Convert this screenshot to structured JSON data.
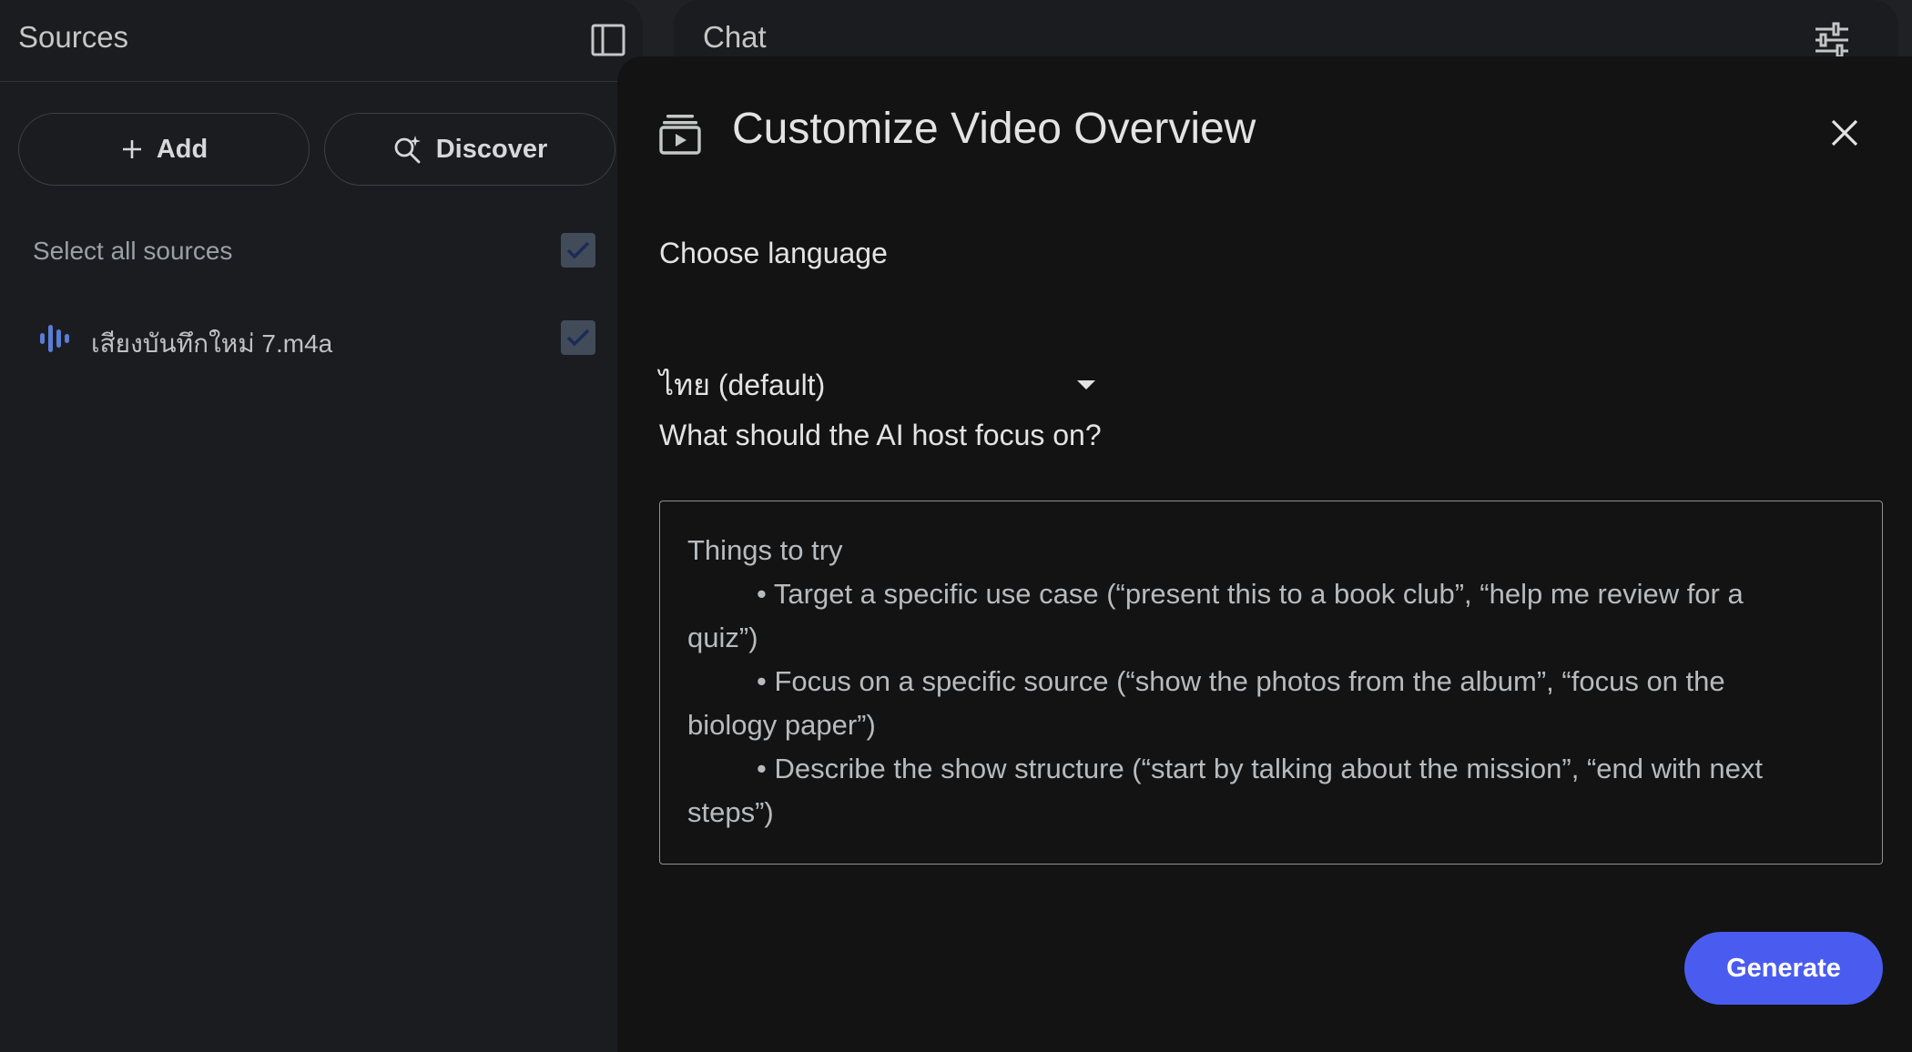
{
  "sources": {
    "title": "Sources",
    "add_label": "Add",
    "discover_label": "Discover",
    "select_all_label": "Select all sources",
    "items": [
      {
        "name": "เสียงบันทึกใหม่ 7.m4a"
      }
    ]
  },
  "chat": {
    "title": "Chat"
  },
  "modal": {
    "title": "Customize Video Overview",
    "language_label": "Choose language",
    "language_value": "ไทย (default)",
    "focus_label": "What should the AI host focus on?",
    "placeholder": {
      "heading": "Things to try",
      "tips": [
        "• Target a specific use case (“present this to a book club”, “help me review for a",
        "quiz”)",
        "• Focus on a specific source (“show the photos from the album”, “focus on the",
        "biology paper”)",
        "• Describe the show structure (“start by talking about the mission”, “end with next",
        "steps”)"
      ]
    },
    "generate_label": "Generate"
  },
  "colors": {
    "accent": "#4a5cf0",
    "checkbox": "#414b5a",
    "audio_icon": "#5b7bd5"
  }
}
